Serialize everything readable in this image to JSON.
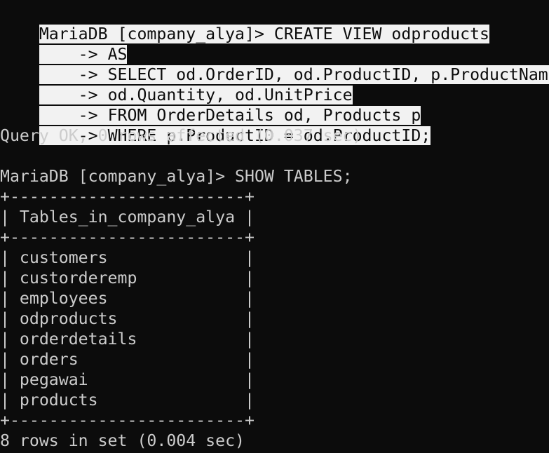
{
  "terminal": {
    "background": "#0c0c0c",
    "foreground": "#cccccc",
    "selection_background": "#f2f2f2",
    "selection_foreground": "#0c0c0c",
    "lines": [
      "MariaDB [company_alya]> CREATE VIEW odproducts",
      "    -> AS",
      "    -> SELECT od.OrderID, od.ProductID, p.ProductName,",
      "    -> od.Quantity, od.UnitPrice",
      "    -> FROM OrderDetails od, Products p",
      "    -> WHERE p.ProductID = od.ProductID;",
      "Query OK, 0 rows affected (0.037 sec)",
      "",
      "MariaDB [company_alya]> SHOW TABLES;",
      "+------------------------+",
      "| Tables_in_company_alya |",
      "+------------------------+",
      "| customers              |",
      "| custorderemp           |",
      "| employees              |",
      "| odproducts             |",
      "| orderdetails           |",
      "| orders                 |",
      "| pegawai                |",
      "| products               |",
      "+------------------------+",
      "8 rows in set (0.004 sec)"
    ]
  }
}
